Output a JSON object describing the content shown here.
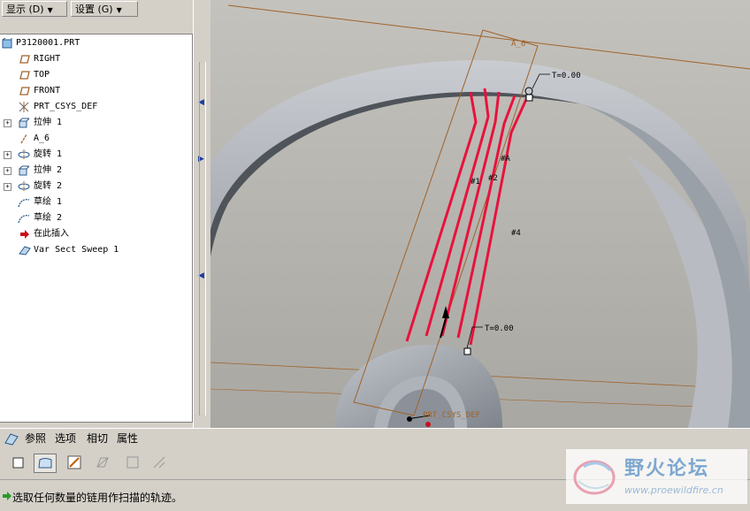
{
  "menu": {
    "display_label": "显示 (D)",
    "settings_label": "设置 (G)"
  },
  "tree": {
    "items": [
      {
        "label": "P3120001.PRT"
      },
      {
        "label": "RIGHT"
      },
      {
        "label": "TOP"
      },
      {
        "label": "FRONT"
      },
      {
        "label": "PRT_CSYS_DEF"
      },
      {
        "label": "拉伸 1"
      },
      {
        "label": "A_6"
      },
      {
        "label": "旋转 1"
      },
      {
        "label": "拉伸 2"
      },
      {
        "label": "旋转 2"
      },
      {
        "label": "草绘 1"
      },
      {
        "label": "草绘 2"
      },
      {
        "label": "在此插入"
      },
      {
        "label": "Var Sect Sweep 1"
      }
    ]
  },
  "viewport": {
    "axis_label": "A_6",
    "t_top": "T=0.00",
    "t_bottom": "T=0.00",
    "csys_label": "PRT_CSYS_DEF",
    "chain_labels": [
      "#A",
      "#1",
      "#2",
      "#4"
    ]
  },
  "dashboard": {
    "tabs": [
      "参照",
      "选项",
      "相切",
      "属性"
    ]
  },
  "status": {
    "message": "选取任何数量的链用作扫描的轨迹。"
  },
  "watermark": {
    "title": "野火论坛",
    "url": "www.proewildfire.cn"
  },
  "colors": {
    "trajectory": "#e8123c",
    "axis": "#a0632a",
    "selection_blue": "#1a3c9c"
  }
}
